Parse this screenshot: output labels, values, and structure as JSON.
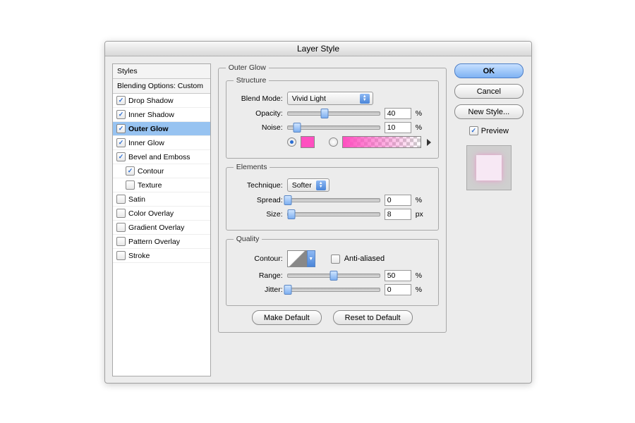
{
  "title": "Layer Style",
  "sidebar": {
    "heading_styles": "Styles",
    "heading_blend": "Blending Options: Custom",
    "items": [
      {
        "label": "Drop Shadow",
        "checked": true
      },
      {
        "label": "Inner Shadow",
        "checked": true
      },
      {
        "label": "Outer Glow",
        "checked": true,
        "selected": true
      },
      {
        "label": "Inner Glow",
        "checked": true
      },
      {
        "label": "Bevel and Emboss",
        "checked": true
      },
      {
        "label": "Contour",
        "checked": true,
        "indent": true
      },
      {
        "label": "Texture",
        "checked": false,
        "indent": true
      },
      {
        "label": "Satin",
        "checked": false
      },
      {
        "label": "Color Overlay",
        "checked": false
      },
      {
        "label": "Gradient Overlay",
        "checked": false
      },
      {
        "label": "Pattern Overlay",
        "checked": false
      },
      {
        "label": "Stroke",
        "checked": false
      }
    ]
  },
  "main": {
    "title": "Outer Glow",
    "structure": {
      "title": "Structure",
      "blend_mode_label": "Blend Mode:",
      "blend_mode_value": "Vivid Light",
      "opacity_label": "Opacity:",
      "opacity_value": "40",
      "opacity_unit": "%",
      "noise_label": "Noise:",
      "noise_value": "10",
      "noise_unit": "%",
      "color_hex": "#ff4fc0"
    },
    "elements": {
      "title": "Elements",
      "technique_label": "Technique:",
      "technique_value": "Softer",
      "spread_label": "Spread:",
      "spread_value": "0",
      "spread_unit": "%",
      "size_label": "Size:",
      "size_value": "8",
      "size_unit": "px"
    },
    "quality": {
      "title": "Quality",
      "contour_label": "Contour:",
      "antialiased_label": "Anti-aliased",
      "range_label": "Range:",
      "range_value": "50",
      "range_unit": "%",
      "jitter_label": "Jitter:",
      "jitter_value": "0",
      "jitter_unit": "%"
    },
    "make_default": "Make Default",
    "reset_default": "Reset to Default"
  },
  "right": {
    "ok": "OK",
    "cancel": "Cancel",
    "new_style": "New Style...",
    "preview": "Preview"
  }
}
